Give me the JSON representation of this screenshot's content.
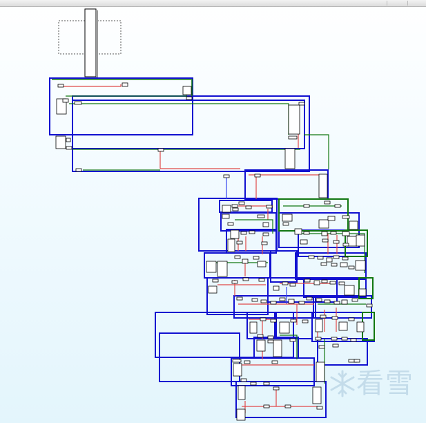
{
  "window": {
    "title": "",
    "colors": {
      "block_border": "#1010d0",
      "edge_true": "#117711",
      "edge_false": "#e04848",
      "edge_uncond": "#3344ee",
      "node_fill": "#ffffff",
      "node_border": "#000000",
      "selection_border": "#555555"
    }
  },
  "graph": {
    "type": "control-flow-graph-overview",
    "view_mode": "zoomed-out",
    "has_selection_frame": true
  },
  "watermark": {
    "text": "看雪",
    "icon": "snow-logo-icon"
  }
}
